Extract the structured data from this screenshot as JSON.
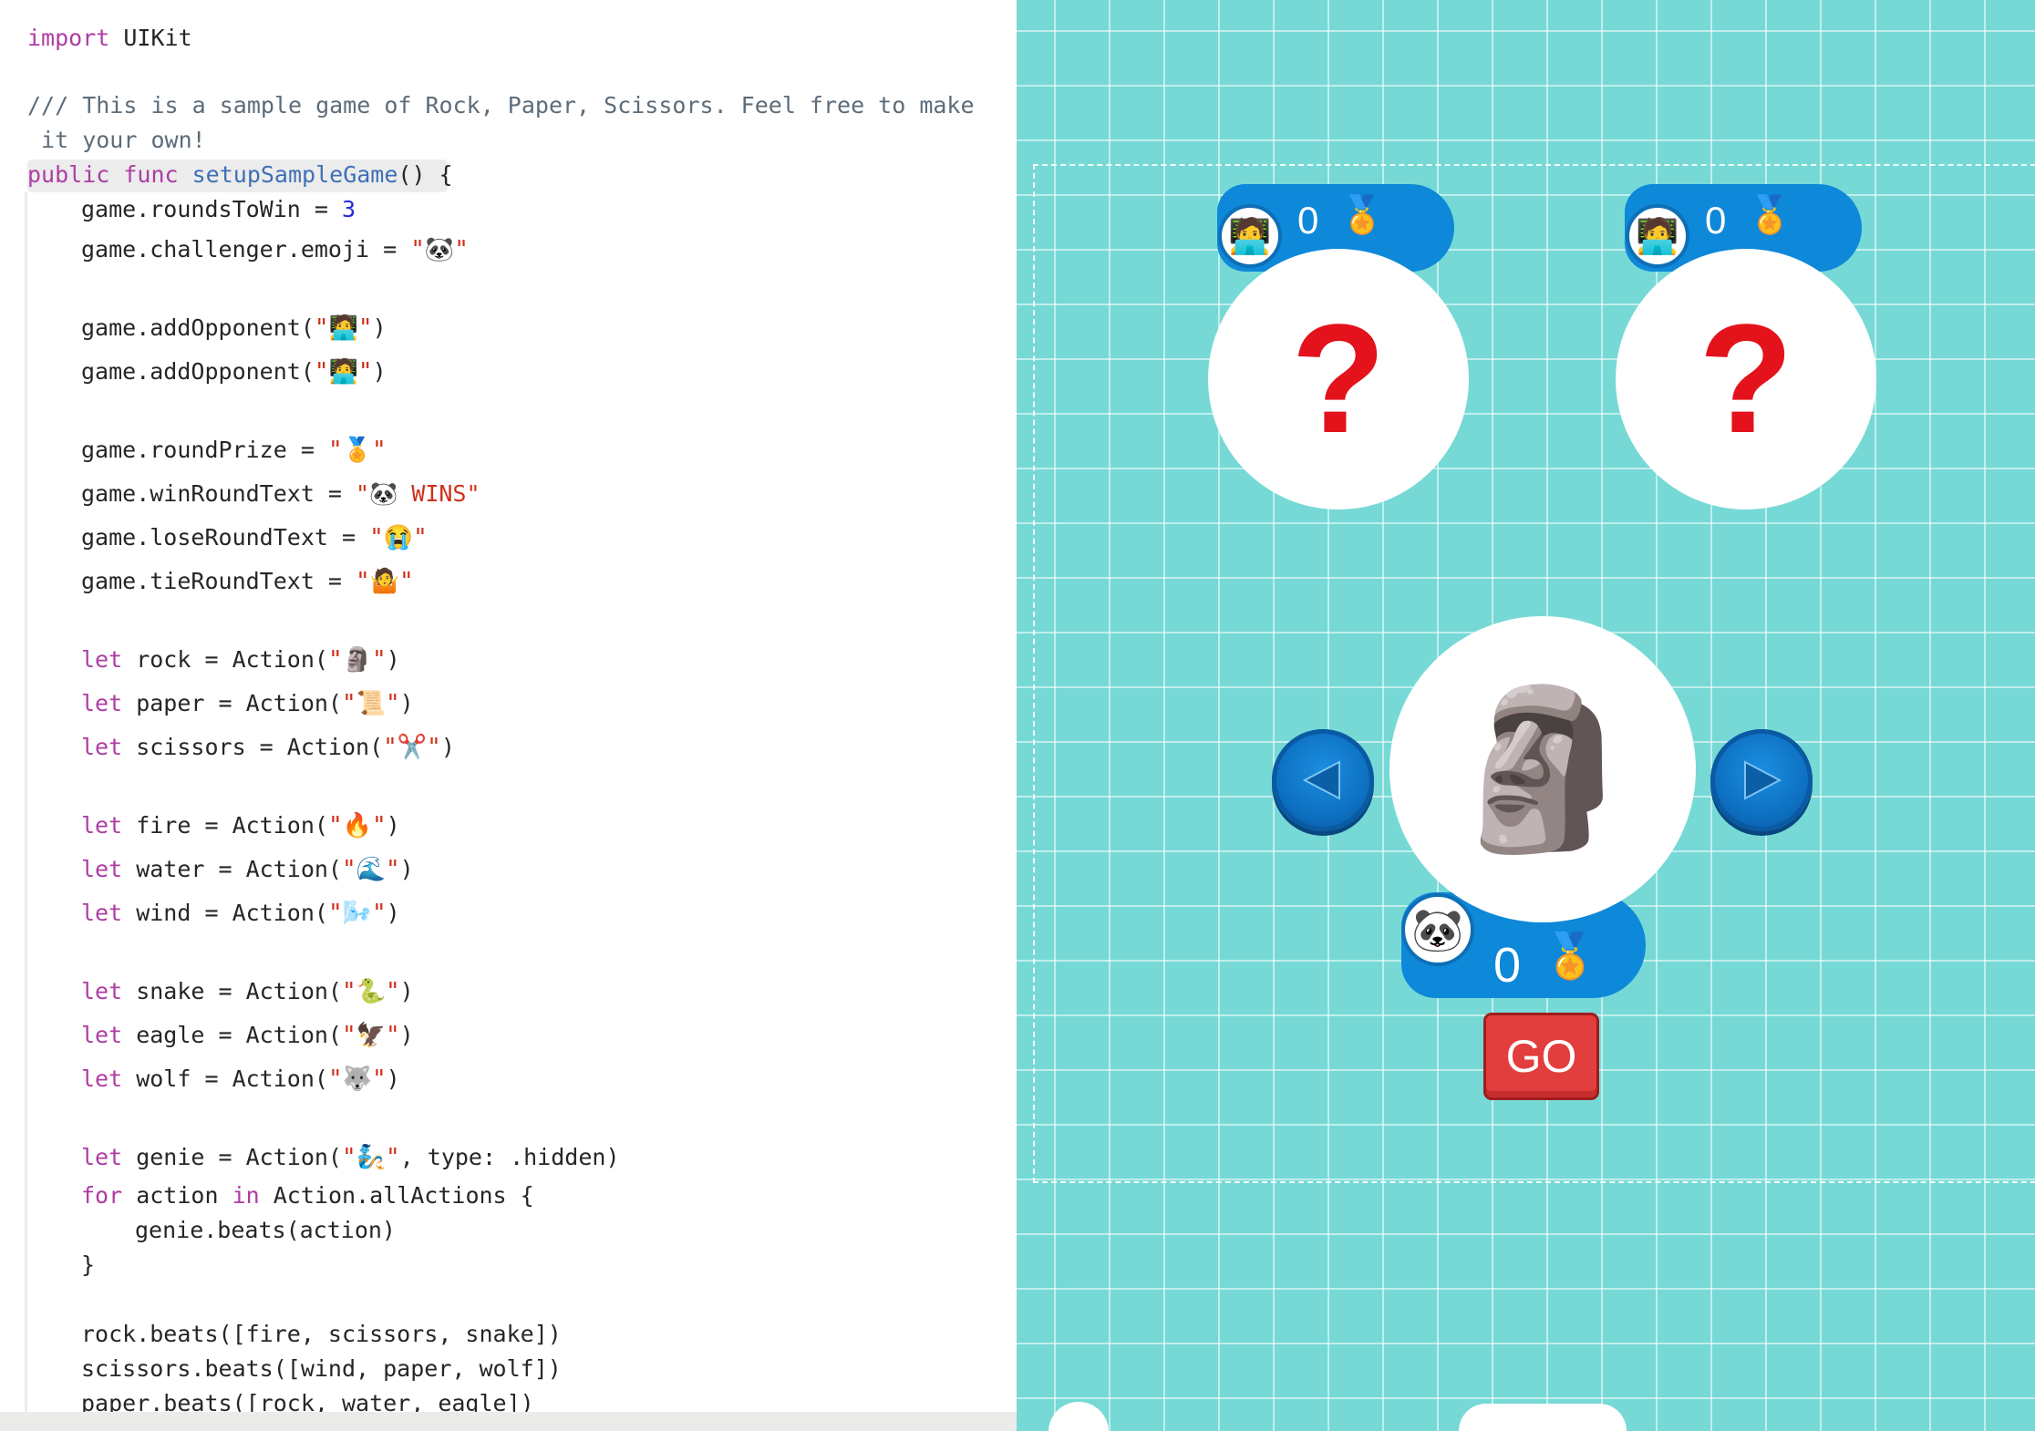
{
  "code": {
    "lines": {
      "l1_kw": "import",
      "l1_rest": " UIKit",
      "l2": "/// This is a sample game of Rock, Paper, Scissors. Feel free to make",
      "l3": " it your own!",
      "l4_kw": "public func",
      "l4_fn": " setupSampleGame",
      "l4_rest": "() {",
      "l5_rest": "game.roundsToWin = ",
      "l5_num": "3",
      "l6_rest": "game.challenger.emoji = ",
      "l6_str": "\"🐼\"",
      "l7_rest": "game.addOpponent(",
      "l7_str": "\"🧑‍💻\"",
      "l7_end": ")",
      "l8_rest": "game.addOpponent(",
      "l8_str": "\"🧑‍💻\"",
      "l8_end": ")",
      "l9_rest": "game.roundPrize = ",
      "l9_str": "\"🏅\"",
      "l10_rest": "game.winRoundText = ",
      "l10_str": "\"🐼 WINS\"",
      "l11_rest": "game.loseRoundText = ",
      "l11_str": "\"😭\"",
      "l12_rest": "game.tieRoundText = ",
      "l12_str": "\"🤷\"",
      "l13_kw": "let",
      "l13_rest": " rock = Action(",
      "l13_str": "\"🗿\"",
      "l13_end": ")",
      "l14_kw": "let",
      "l14_rest": " paper = Action(",
      "l14_str": "\"📜\"",
      "l14_end": ")",
      "l15_kw": "let",
      "l15_rest": " scissors = Action(",
      "l15_str": "\"✂️\"",
      "l15_end": ")",
      "l16_kw": "let",
      "l16_rest": " fire = Action(",
      "l16_str": "\"🔥\"",
      "l16_end": ")",
      "l17_kw": "let",
      "l17_rest": " water = Action(",
      "l17_str": "\"🌊\"",
      "l17_end": ")",
      "l18_kw": "let",
      "l18_rest": " wind = Action(",
      "l18_str": "\"🌬️\"",
      "l18_end": ")",
      "l19_kw": "let",
      "l19_rest": " snake = Action(",
      "l19_str": "\"🐍\"",
      "l19_end": ")",
      "l20_kw": "let",
      "l20_rest": " eagle = Action(",
      "l20_str": "\"🦅\"",
      "l20_end": ")",
      "l21_kw": "let",
      "l21_rest": " wolf = Action(",
      "l21_str": "\"🐺\"",
      "l21_end": ")",
      "l22_kw": "let",
      "l22_rest": " genie = Action(",
      "l22_str": "\"🧞\"",
      "l22_end": ", type: .hidden)",
      "l23_kw1": "for",
      "l23_mid": " action ",
      "l23_kw2": "in",
      "l23_rest": " Action.allActions {",
      "l24": "genie.beats(action)",
      "l25": "}",
      "l26": "rock.beats([fire, scissors, snake])",
      "l27": "scissors.beats([wind, paper, wolf])",
      "l28": "paper.beats([rock, water, eagle])"
    }
  },
  "live_view": {
    "opponent1": {
      "avatar": "🧑‍💻",
      "score": "0",
      "prize": "🏅",
      "choice": "?"
    },
    "opponent2": {
      "avatar": "🧑‍💻",
      "score": "0",
      "prize": "🏅",
      "choice": "?"
    },
    "player": {
      "avatar": "🐼",
      "score": "0",
      "prize": "🏅",
      "selected_action": "🗿"
    },
    "go_label": "GO",
    "icons": {
      "prev": "left-arrow-icon",
      "next": "right-arrow-icon"
    },
    "colors": {
      "background": "#76d9d6",
      "pill": "#0e88d8",
      "go": "#e23e3d",
      "question": "#e3121b"
    }
  }
}
